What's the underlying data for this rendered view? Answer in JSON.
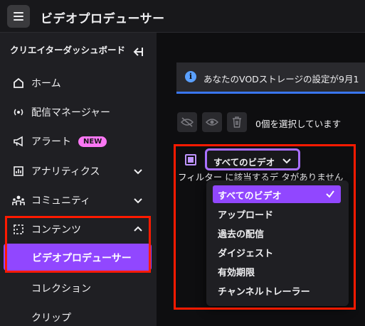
{
  "topbar": {
    "title": "ビデオプロデューサー"
  },
  "sidebar": {
    "header": "クリエイターダッシュボード",
    "items": [
      {
        "label": "ホーム",
        "icon": "home-icon"
      },
      {
        "label": "配信マネージャー",
        "icon": "broadcast-icon"
      },
      {
        "label": "アラート",
        "icon": "megaphone-icon",
        "badge": "NEW"
      },
      {
        "label": "アナリティクス",
        "icon": "analytics-icon",
        "expanded": false
      },
      {
        "label": "コミュニティ",
        "icon": "community-icon",
        "expanded": false
      },
      {
        "label": "コンテンツ",
        "icon": "content-icon",
        "expanded": true
      }
    ],
    "sub_items": [
      {
        "label": "ビデオプロデューサー",
        "active": true
      },
      {
        "label": "コレクション",
        "active": false
      },
      {
        "label": "クリップ",
        "active": false
      }
    ]
  },
  "banner": {
    "text": "あなたのVODストレージの設定が9月1"
  },
  "toolbar": {
    "selection_text": "0個を選択しています"
  },
  "filter": {
    "selected_label": "すべてのビデオ",
    "partial_text": "フィルター に該当するデ タがありません",
    "options": [
      {
        "label": "すべてのビデオ",
        "selected": true
      },
      {
        "label": "アップロード",
        "selected": false
      },
      {
        "label": "過去の配信",
        "selected": false
      },
      {
        "label": "ダイジェスト",
        "selected": false
      },
      {
        "label": "有効期限",
        "selected": false
      },
      {
        "label": "チャンネルトレーラー",
        "selected": false
      }
    ]
  },
  "colors": {
    "accent": "#9147ff",
    "highlight": "#ff1a00",
    "badge": "#fb77f4",
    "info": "#3a76f0"
  }
}
